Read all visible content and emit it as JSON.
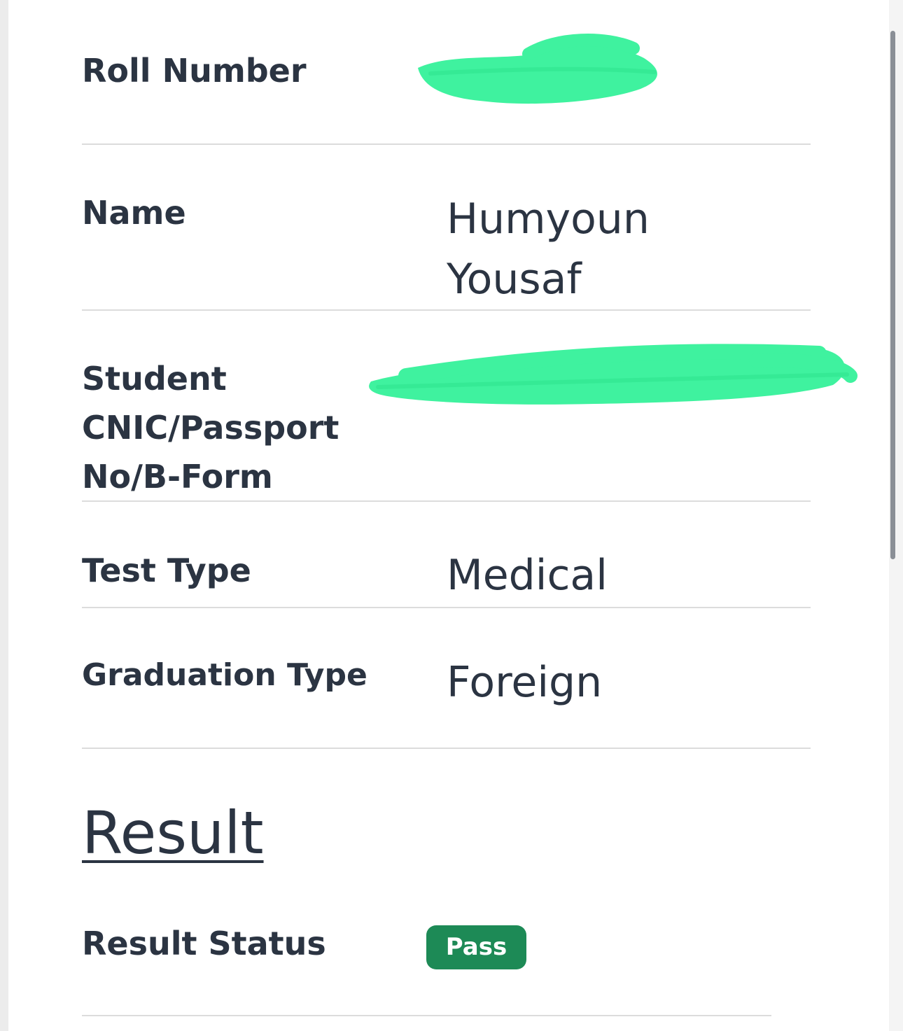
{
  "fields": {
    "roll_number": {
      "label": "Roll Number",
      "value": ""
    },
    "name": {
      "label": "Name",
      "value_line1": "Humyoun",
      "value_line2": "Yousaf"
    },
    "cnic": {
      "label_line1": "Student",
      "label_line2": "CNIC/Passport",
      "label_line3": "No/B-Form",
      "value": ""
    },
    "test_type": {
      "label": "Test Type",
      "value": "Medical"
    },
    "graduation_type": {
      "label": "Graduation Type",
      "value": "Foreign"
    }
  },
  "result": {
    "heading": "Result",
    "status_label": "Result Status",
    "status_badge": "Pass"
  },
  "colors": {
    "text": "#2b3442",
    "divider": "#dcdcdc",
    "redaction": "#3ff29f",
    "badge_bg": "#1d8a56",
    "badge_text": "#ffffff"
  }
}
